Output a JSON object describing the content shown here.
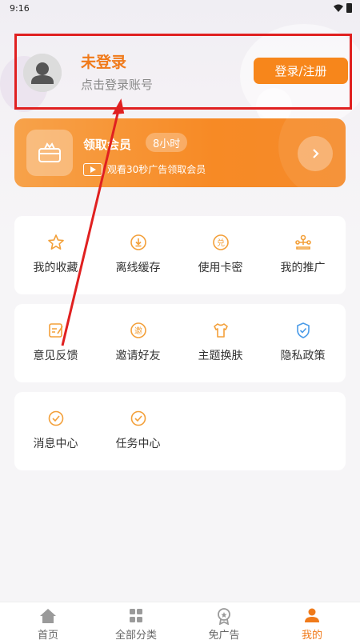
{
  "status_bar": {
    "time": "9:16"
  },
  "profile": {
    "title": "未登录",
    "subtitle": "点击登录账号",
    "login_button": "登录/注册"
  },
  "vip_card": {
    "title": "领取会员",
    "badge": "8小时",
    "subtitle": "观看30秒广告领取会员"
  },
  "grid_sections": [
    [
      {
        "label": "我的收藏",
        "icon": "star-icon"
      },
      {
        "label": "离线缓存",
        "icon": "download-icon"
      },
      {
        "label": "使用卡密",
        "icon": "redeem-icon"
      },
      {
        "label": "我的推广",
        "icon": "share-tree-icon"
      }
    ],
    [
      {
        "label": "意见反馈",
        "icon": "feedback-icon"
      },
      {
        "label": "邀请好友",
        "icon": "invite-icon"
      },
      {
        "label": "主题换肤",
        "icon": "shirt-icon"
      },
      {
        "label": "隐私政策",
        "icon": "shield-icon"
      }
    ],
    [
      {
        "label": "消息中心",
        "icon": "check-circle-icon"
      },
      {
        "label": "任务中心",
        "icon": "check-circle-icon"
      }
    ]
  ],
  "bottom_nav": [
    {
      "label": "首页",
      "icon": "home-icon"
    },
    {
      "label": "全部分类",
      "icon": "grid-icon"
    },
    {
      "label": "免广告",
      "icon": "award-icon"
    },
    {
      "label": "我的",
      "icon": "user-icon"
    }
  ],
  "colors": {
    "accent": "#f07a1a",
    "annotation": "#e02020",
    "icon_orange": "#f3a03a"
  }
}
